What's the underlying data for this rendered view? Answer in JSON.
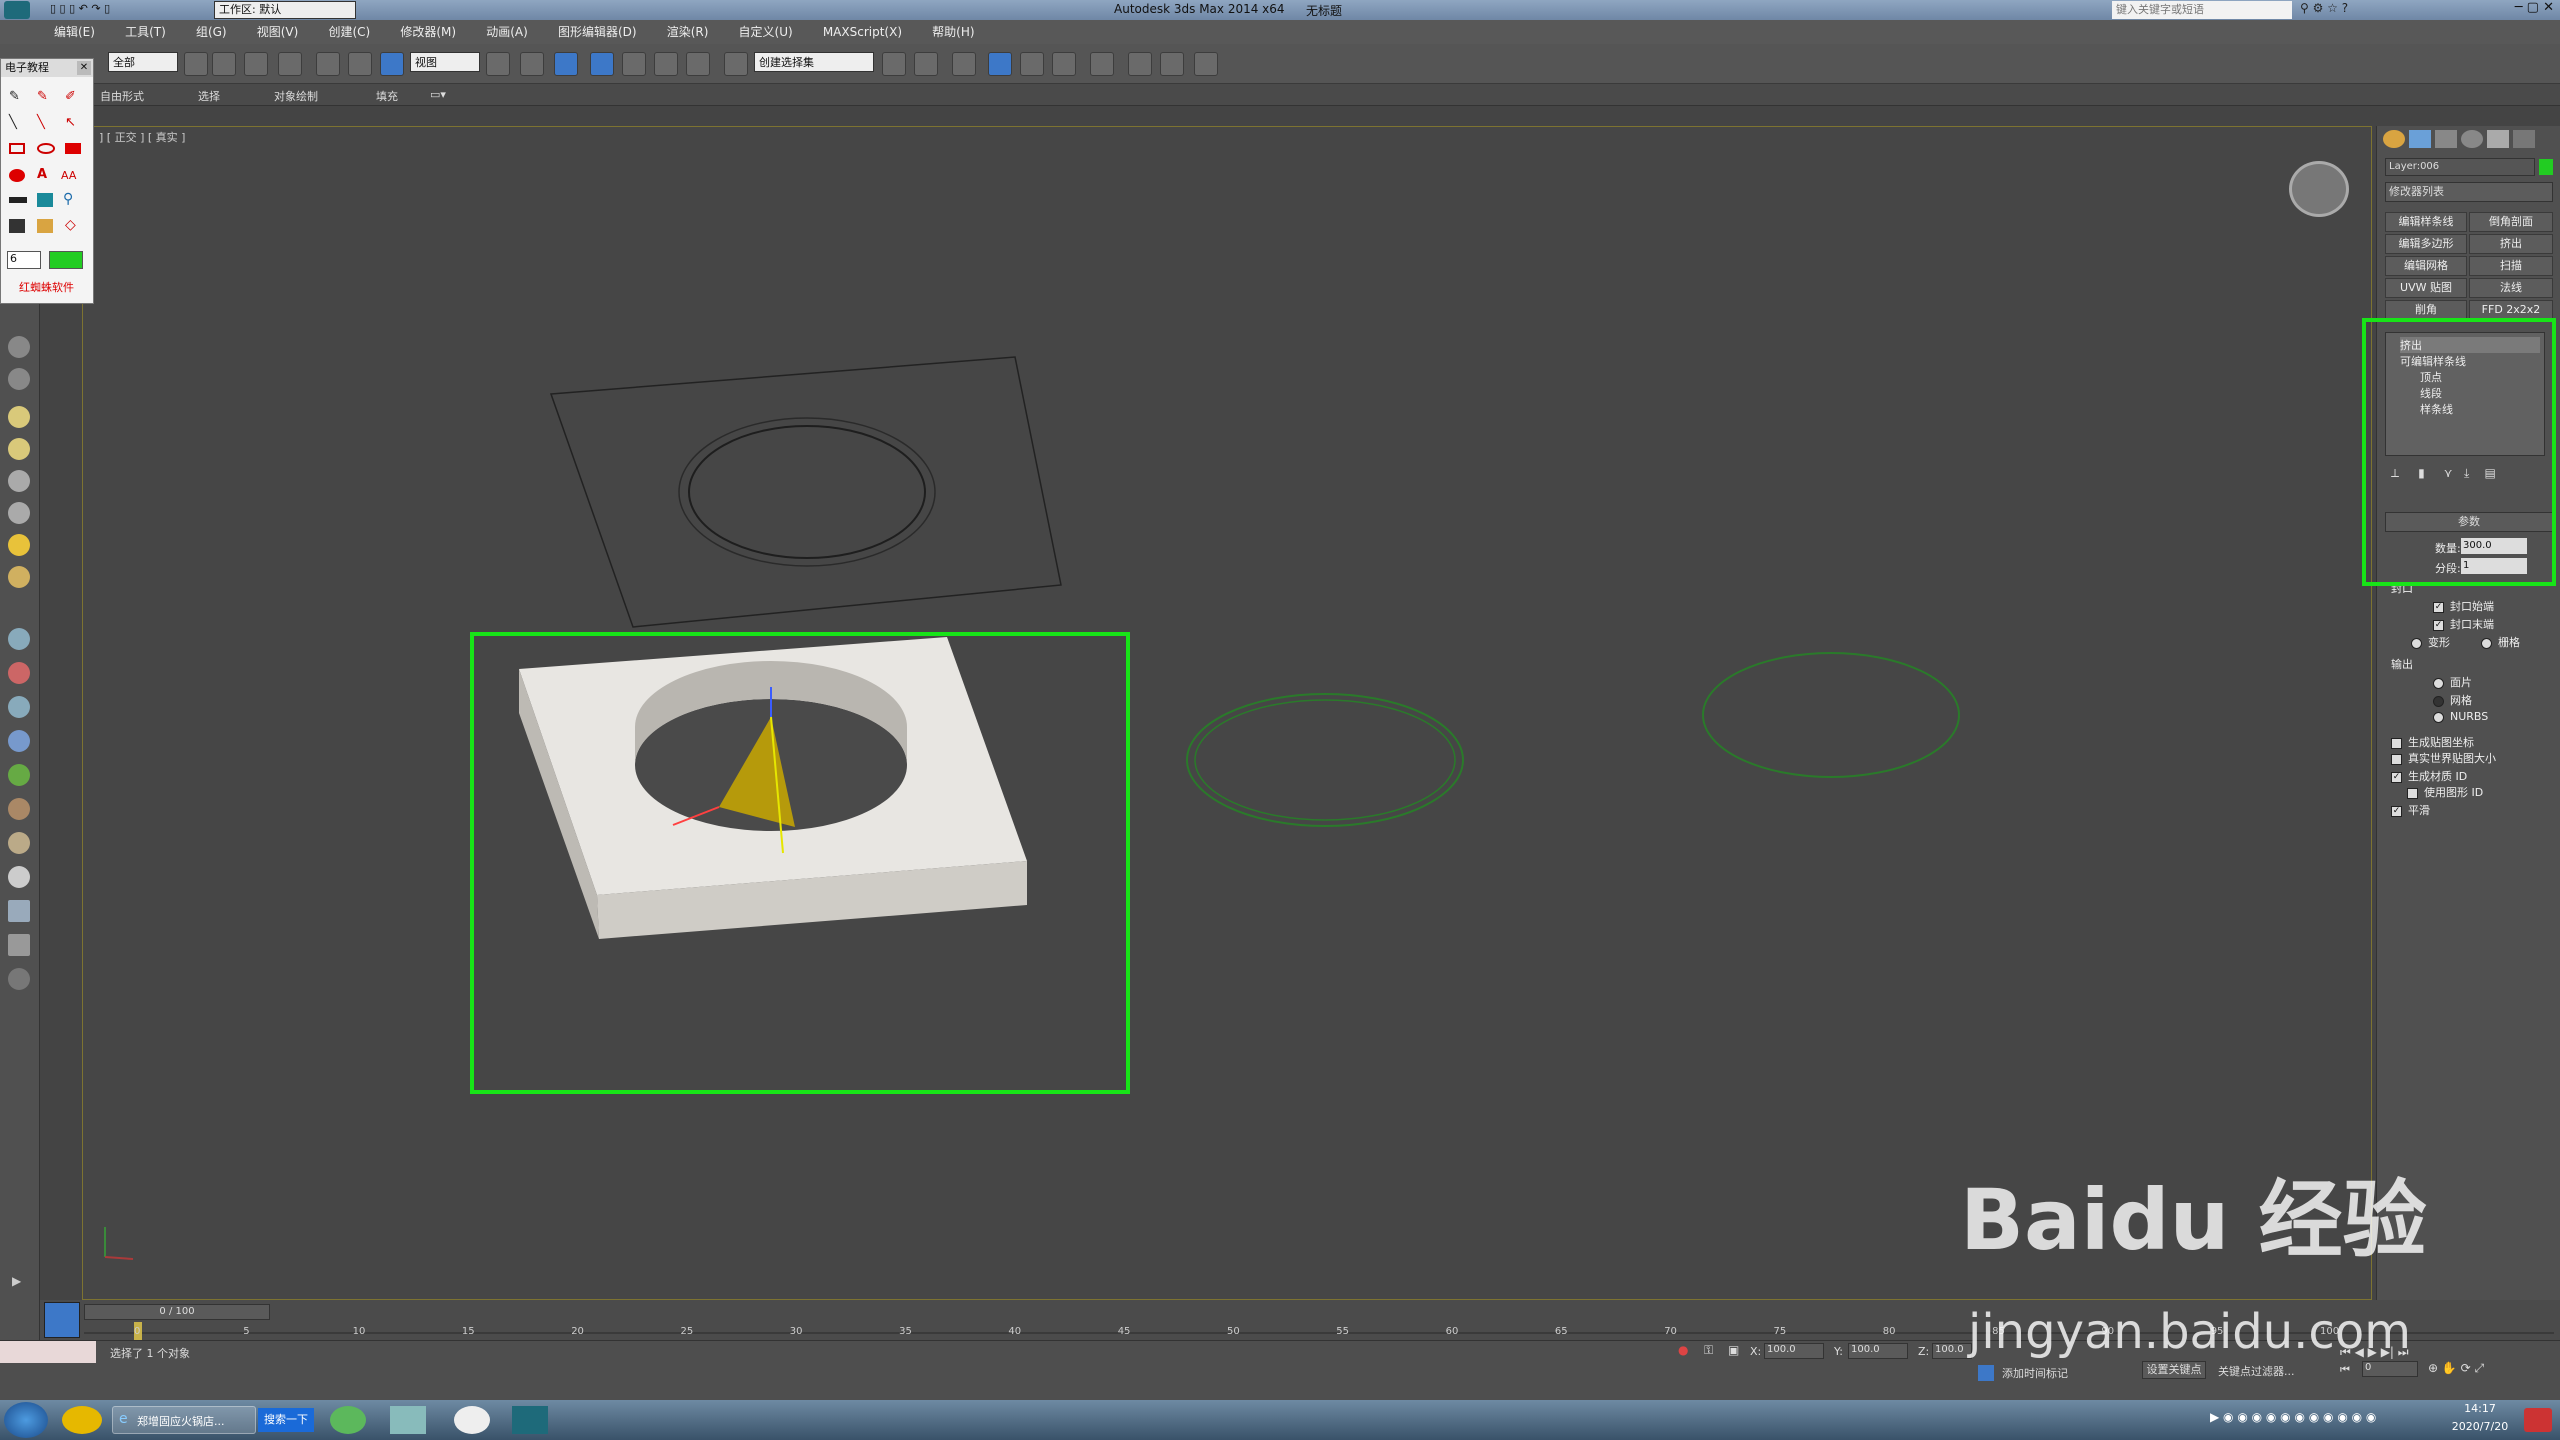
{
  "titlebar": {
    "workspace": "工作区: 默认",
    "app_title": "Autodesk 3ds Max  2014 x64",
    "doc_title": "无标题",
    "search_placeholder": "键入关键字或短语"
  },
  "menu": [
    "编辑(E)",
    "工具(T)",
    "组(G)",
    "视图(V)",
    "创建(C)",
    "修改器(M)",
    "动画(A)",
    "图形编辑器(D)",
    "渲染(R)",
    "自定义(U)",
    "MAXScript(X)",
    "帮助(H)"
  ],
  "toolbar": {
    "selection_filter": "全部",
    "ref_coord": "视图",
    "named_selection": "创建选择集"
  },
  "ribbon": [
    "自由形式",
    "选择",
    "对象绘制",
    "填充"
  ],
  "e_tutorial": {
    "title": "电子教程",
    "size_value": "6",
    "brand": "红蜘蛛软件",
    "text_tool": "AA"
  },
  "viewport": {
    "label": "] [ 正交 ] [ 真实 ]"
  },
  "cmdpanel": {
    "object_name": "Layer:006",
    "modifier_list": "修改器列表",
    "mod_buttons": [
      "编辑样条线",
      "倒角剖面",
      "编辑多边形",
      "挤出",
      "编辑网格",
      "扫描",
      "UVW 贴图",
      "法线",
      "削角",
      "FFD 2x2x2"
    ],
    "stack": [
      "挤出",
      "可编辑样条线",
      "顶点",
      "线段",
      "样条线"
    ],
    "params_title": "参数",
    "amount_label": "数量:",
    "amount_value": "300.0",
    "segments_label": "分段:",
    "segments_value": "1",
    "cap_title": "封口",
    "cap_start": "封口始端",
    "cap_end": "封口末端",
    "morph": "变形",
    "grid": "栅格",
    "output_title": "输出",
    "patch": "面片",
    "mesh": "网格",
    "nurbs": "NURBS",
    "gen_map": "生成贴图坐标",
    "real_world": "真实世界贴图大小",
    "gen_mat": "生成材质 ID",
    "use_shape": "使用图形 ID",
    "smooth": "平滑"
  },
  "timeline": {
    "frame": "0 / 100",
    "ticks": [
      "0",
      "5",
      "10",
      "15",
      "20",
      "25",
      "30",
      "35",
      "40",
      "45",
      "50",
      "55",
      "60",
      "65",
      "70",
      "75",
      "80",
      "85",
      "90",
      "95",
      "100"
    ]
  },
  "status": {
    "selection": "选择了 1 个对象",
    "x_value": "100.0",
    "y_value": "100.0",
    "z_value": "100.0",
    "add_time_tag": "添加时间标记",
    "set_key": "设置关键点",
    "key_filter": "关键点过滤器...",
    "frame_value": "0"
  },
  "taskbar": {
    "ie_label": "郑增固应火锅店...",
    "search_btn": "搜索一下",
    "time": "14:17",
    "date": "2020/7/20"
  },
  "watermark": "Baidu 经验",
  "watermark_url": "jingyan.baidu.com"
}
